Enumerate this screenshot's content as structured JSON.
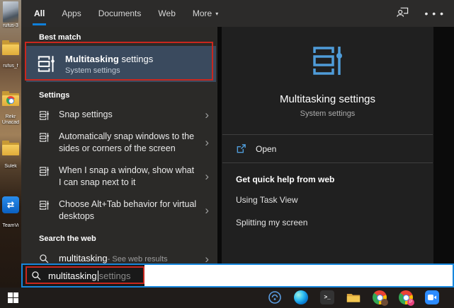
{
  "topbar": {
    "tabs": [
      {
        "label": "All",
        "selected": true
      },
      {
        "label": "Apps",
        "selected": false
      },
      {
        "label": "Documents",
        "selected": false
      },
      {
        "label": "Web",
        "selected": false
      },
      {
        "label": "More",
        "selected": false
      }
    ],
    "more_caret": "▾",
    "ellipsis_glyph": "• • •"
  },
  "left_panel": {
    "best_match_header": "Best match",
    "best_match": {
      "title_bold": "Multitasking",
      "title_rest": " settings",
      "subtitle": "System settings"
    },
    "settings_header": "Settings",
    "settings_items": [
      "Snap settings",
      "Automatically snap windows to the sides or corners of the screen",
      "When I snap a window, show what I can snap next to it",
      "Choose Alt+Tab behavior for virtual desktops"
    ],
    "web_header": "Search the web",
    "web_query": "multitasking",
    "web_suffix": " - See web results"
  },
  "right_panel": {
    "title": "Multitasking settings",
    "subtitle": "System settings",
    "open_label": "Open",
    "help_header": "Get quick help from web",
    "help_links": [
      "Using Task View",
      "Splitting my screen"
    ]
  },
  "search_bar": {
    "typed": "multitasking",
    "suggestion": "settings"
  },
  "desktop": {
    "icons": [
      {
        "label": "rufus-3"
      },
      {
        "label": "rufus_f"
      },
      {
        "label": "Rekr"
      },
      {
        "label": "Unacad"
      },
      {
        "label": "Sulek"
      },
      {
        "label": "TeamVi"
      }
    ],
    "teamviewer_glyph": "⇄"
  },
  "taskbar": {
    "icons": [
      "connect",
      "edge",
      "terminal",
      "file-explorer",
      "chrome",
      "chrome-profile",
      "zoom"
    ],
    "terminal_glyph": ">_"
  },
  "icons": {
    "chevron": "›"
  },
  "colors": {
    "accent_blue": "#0f7fd9",
    "annotation_red": "#c9271e",
    "selection_blue_gray": "#3a4a5e",
    "icon_blue": "#4f9cd9",
    "search_border_blue": "#1787dd"
  }
}
